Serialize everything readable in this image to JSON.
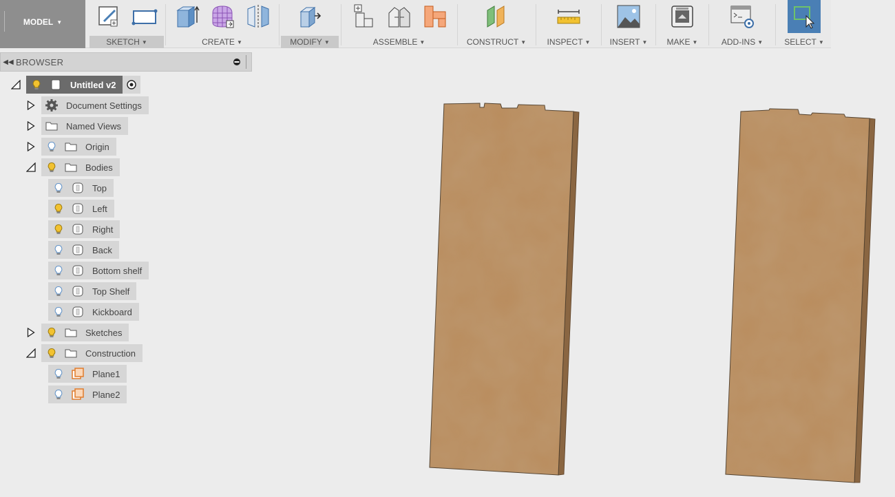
{
  "toolbar": {
    "workspace": "MODEL",
    "groups": {
      "sketch": "SKETCH",
      "create": "CREATE",
      "modify": "MODIFY",
      "assemble": "ASSEMBLE",
      "construct": "CONSTRUCT",
      "inspect": "INSPECT",
      "insert": "INSERT",
      "make": "MAKE",
      "addins": "ADD-INS",
      "select": "SELECT"
    }
  },
  "browser": {
    "title": "BROWSER",
    "root": "Untitled v2",
    "items": {
      "document_settings": "Document Settings",
      "named_views": "Named Views",
      "origin": "Origin",
      "bodies": "Bodies",
      "top": "Top",
      "left": "Left",
      "right": "Right",
      "back": "Back",
      "bottom_shelf": "Bottom shelf",
      "top_shelf": "Top Shelf",
      "kickboard": "Kickboard",
      "sketches": "Sketches",
      "construction": "Construction",
      "plane1": "Plane1",
      "plane2": "Plane2"
    }
  },
  "colors": {
    "accent": "#4a7fb5",
    "board": "#b98c5d",
    "board_edge": "#8a6642",
    "bulb_on": "#f2c230",
    "bulb_off": "#8ab4dd",
    "plane": "#e07b2b"
  },
  "icons": [
    "sketch-icon",
    "rectangle-icon",
    "extrude-icon",
    "form-icon",
    "mirror-icon",
    "press-pull-icon",
    "new-component-icon",
    "joint-icon",
    "as-built-joint-icon",
    "offset-plane-icon",
    "measure-icon",
    "insert-image-icon",
    "3d-print-icon",
    "scripts-icon",
    "select-icon",
    "gear-icon",
    "folder-icon",
    "bulb-icon",
    "body-icon",
    "plane-icon"
  ]
}
